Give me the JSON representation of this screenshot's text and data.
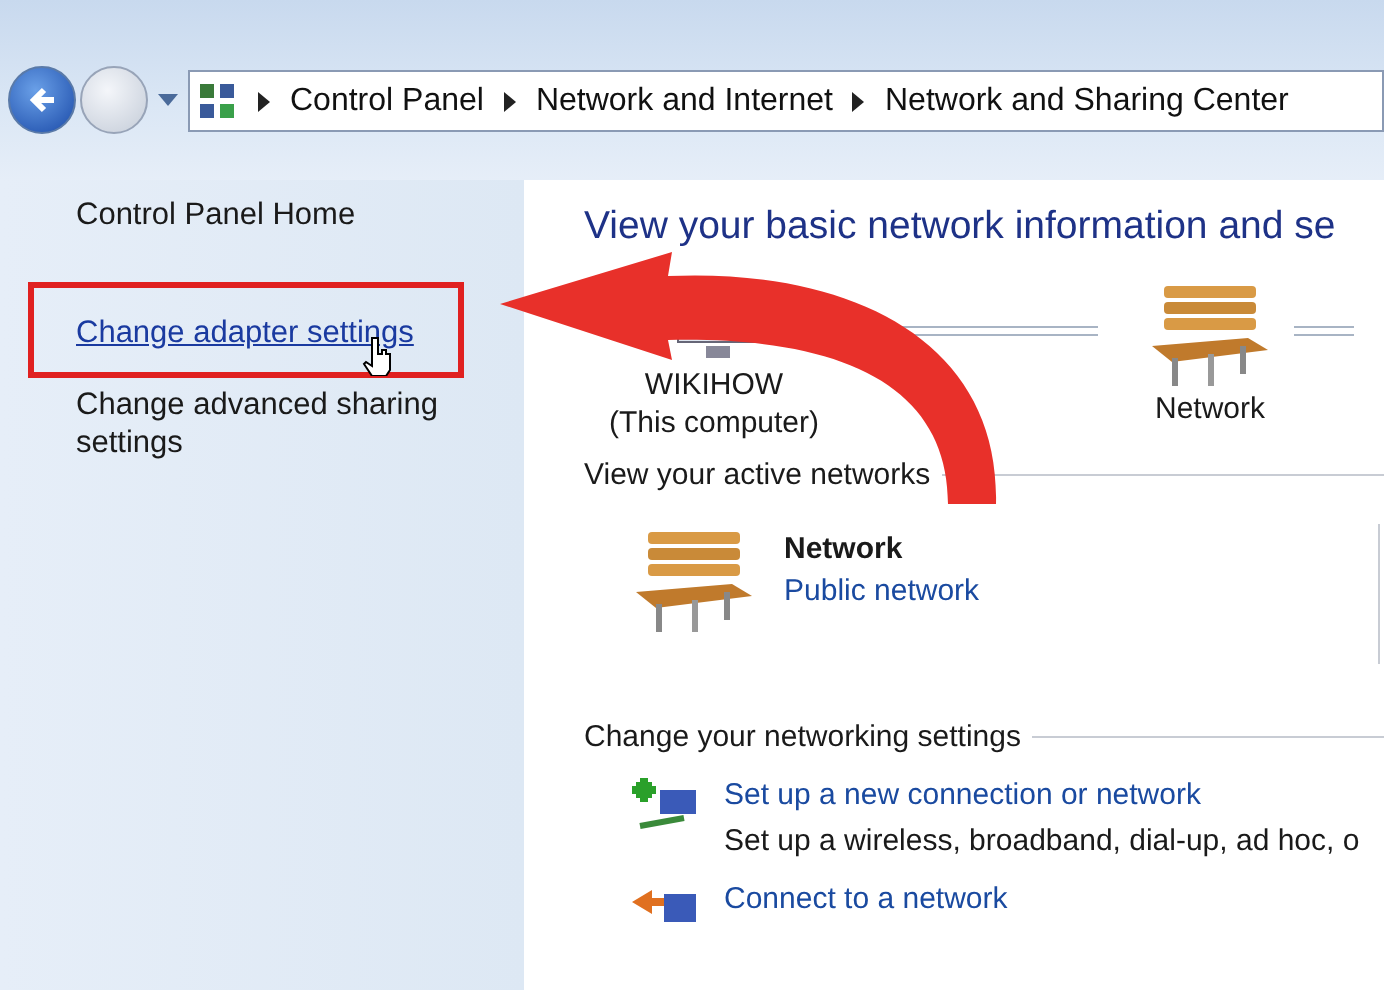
{
  "nav": {
    "breadcrumb": [
      "Control Panel",
      "Network and Internet",
      "Network and Sharing Center"
    ]
  },
  "sidebar": {
    "items": [
      {
        "label": "Control Panel Home",
        "kind": "plain",
        "highlighted": false
      },
      {
        "label": "Change adapter settings",
        "kind": "link",
        "highlighted": true
      },
      {
        "label": "Change advanced sharing settings",
        "kind": "plain",
        "highlighted": false
      }
    ]
  },
  "main": {
    "title": "View your basic network information and se",
    "map": [
      {
        "name": "WIKIHOW",
        "detail": "(This computer)",
        "kind": "computer"
      },
      {
        "name": "Network",
        "kind": "network"
      }
    ],
    "active_networks": {
      "heading": "View your active networks",
      "network": {
        "name": "Network",
        "type": "Public network"
      }
    },
    "settings": {
      "heading": "Change your networking settings",
      "tasks": [
        {
          "link": "Set up a new connection or network",
          "description": "Set up a wireless, broadband, dial-up, ad hoc, o",
          "kind": "new"
        },
        {
          "link": "Connect to a network",
          "kind": "connect"
        }
      ]
    }
  }
}
